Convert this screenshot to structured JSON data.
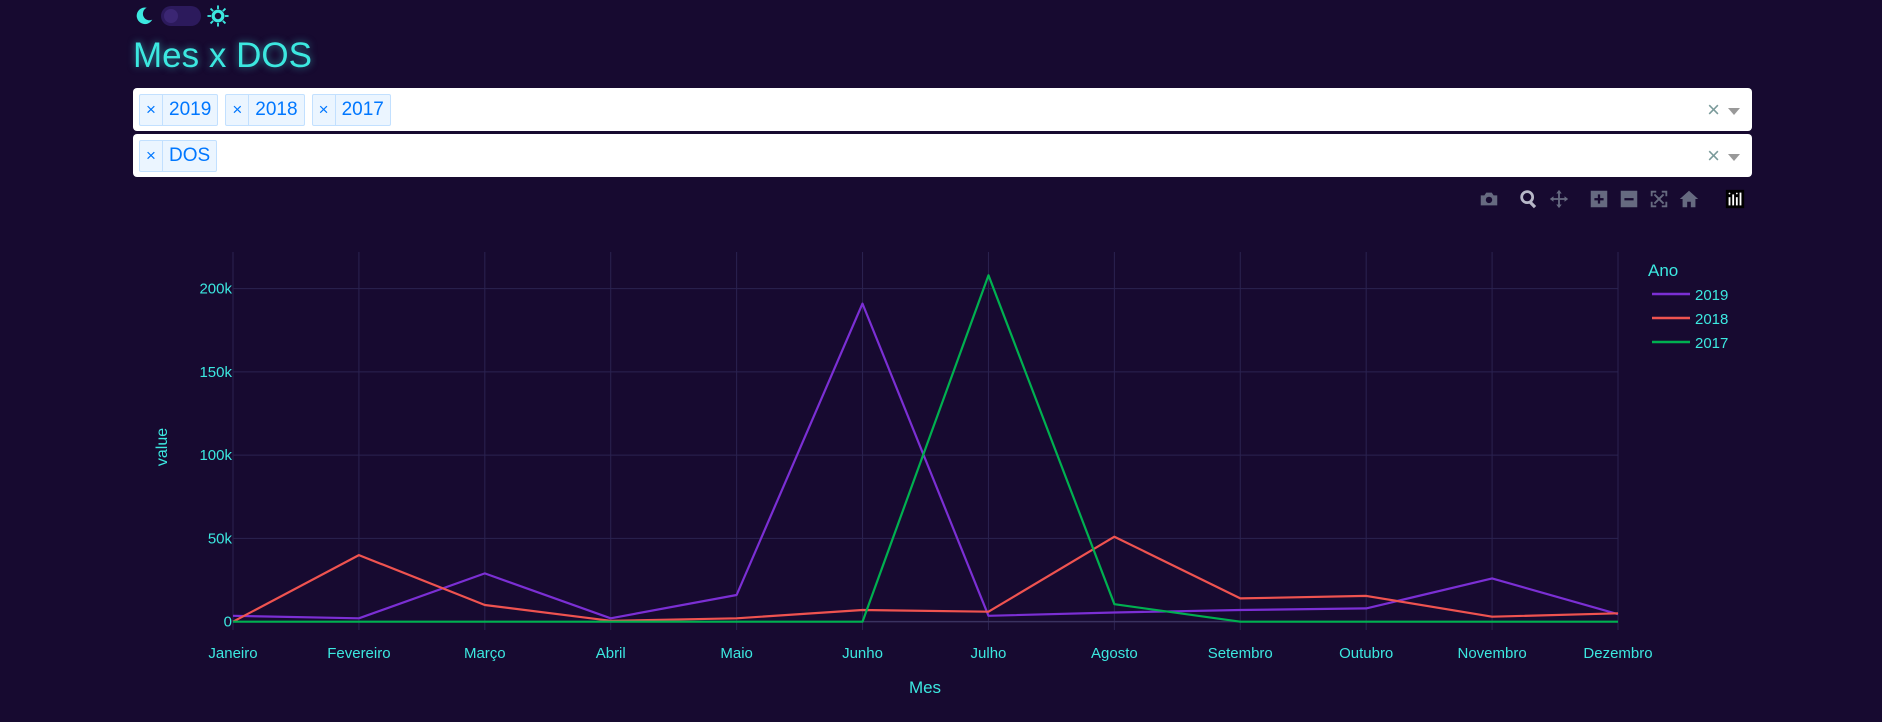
{
  "header": {
    "title": "Mes x DOS",
    "theme_toggle": {
      "left_icon": "moon-icon",
      "right_icon": "sun-icon",
      "state": "dark"
    }
  },
  "filters": {
    "years": [
      "2019",
      "2018",
      "2017"
    ],
    "columns": [
      "DOS"
    ],
    "remove_glyph": "×",
    "clear_glyph": "×"
  },
  "modebar": [
    "camera-icon",
    "zoom-icon",
    "pan-icon",
    "zoom-in-icon",
    "zoom-out-icon",
    "autoscale-icon",
    "reset-axes-icon",
    "plotly-logo-icon"
  ],
  "colors": {
    "background": "#170a30",
    "text": "#3ce8e0",
    "grid": "#2b2350"
  },
  "chart_data": {
    "type": "line",
    "title": "",
    "xlabel": "Mes",
    "ylabel": "value",
    "categories": [
      "Janeiro",
      "Fevereiro",
      "Março",
      "Abril",
      "Maio",
      "Junho",
      "Julho",
      "Agosto",
      "Setembro",
      "Outubro",
      "Novembro",
      "Dezembro"
    ],
    "ylim": [
      -5000,
      222000
    ],
    "yticks": [
      0,
      50000,
      100000,
      150000,
      200000
    ],
    "ytick_labels": [
      "0",
      "50k",
      "100k",
      "150k",
      "200k"
    ],
    "grid": true,
    "legend": {
      "title": "Ano",
      "position": "top-right"
    },
    "series": [
      {
        "name": "2019",
        "color": "#7b2fd4",
        "values": [
          3500,
          2000,
          29000,
          2000,
          16000,
          191000,
          3500,
          5500,
          7000,
          8000,
          26000,
          4500
        ]
      },
      {
        "name": "2018",
        "color": "#ef5350",
        "values": [
          0,
          40000,
          10000,
          500,
          2000,
          7000,
          6000,
          51000,
          14000,
          15500,
          3000,
          5000
        ]
      },
      {
        "name": "2017",
        "color": "#00b050",
        "values": [
          0,
          0,
          0,
          0,
          0,
          0,
          208000,
          10500,
          0,
          0,
          0,
          0
        ]
      }
    ]
  }
}
